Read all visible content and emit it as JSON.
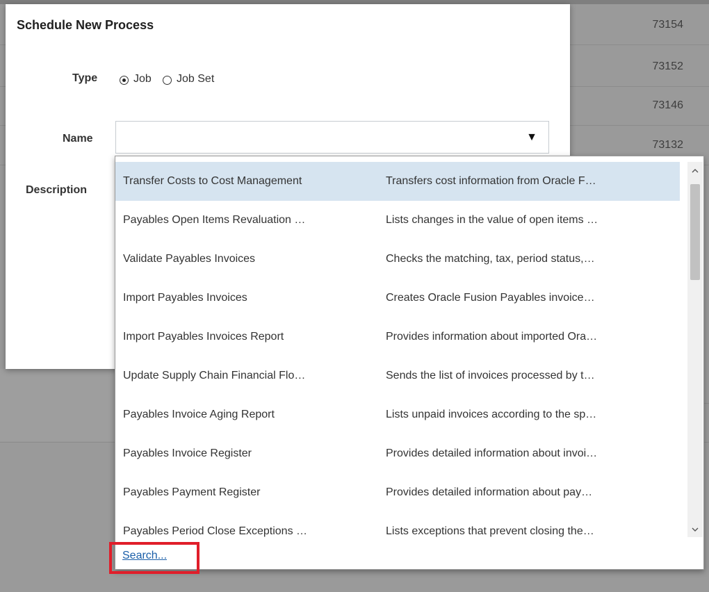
{
  "background": {
    "ids": [
      "73154",
      "73152",
      "73146",
      "73132"
    ]
  },
  "dialog": {
    "title": "Schedule New Process",
    "type_label": "Type",
    "type_options": [
      {
        "label": "Job",
        "checked": true
      },
      {
        "label": "Job Set",
        "checked": false
      }
    ],
    "name_label": "Name",
    "name_value": "",
    "description_label": "Description"
  },
  "dropdown": {
    "rows": [
      {
        "name": "Transfer Costs to Cost Management",
        "desc": "Transfers cost information from Oracle F…",
        "selected": true
      },
      {
        "name": "Payables Open Items Revaluation …",
        "desc": "Lists changes in the value of open items …"
      },
      {
        "name": "Validate Payables Invoices",
        "desc": "Checks the matching, tax, period status,…"
      },
      {
        "name": "Import Payables Invoices",
        "desc": "Creates Oracle Fusion Payables invoice…"
      },
      {
        "name": "Import Payables Invoices Report",
        "desc": "Provides information about imported Ora…"
      },
      {
        "name": "Update Supply Chain Financial Flo…",
        "desc": "Sends the list of invoices processed by t…"
      },
      {
        "name": "Payables Invoice Aging Report",
        "desc": "Lists unpaid invoices according to the sp…"
      },
      {
        "name": "Payables Invoice Register",
        "desc": "Provides detailed information about invoi…"
      },
      {
        "name": "Payables Payment Register",
        "desc": "Provides detailed information about pay…"
      },
      {
        "name": "Payables Period Close Exceptions …",
        "desc": "Lists exceptions that prevent closing the…"
      }
    ],
    "search_link": "Search..."
  },
  "colors": {
    "selected_row": "#d6e4f0",
    "link": "#1a5ea8",
    "highlight": "#e01e2a"
  },
  "icons": {
    "dropdown": "triangle-down",
    "scroll_up": "chevron-up",
    "scroll_down": "chevron-down"
  }
}
